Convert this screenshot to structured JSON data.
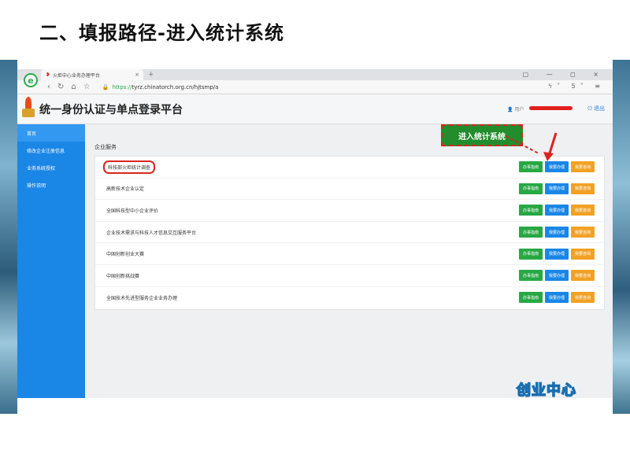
{
  "slide": {
    "title": "二、填报路径-进入统计系统"
  },
  "browser": {
    "logo": "e",
    "tab_title": "火炬中心业务办理平台",
    "tab_close": "×",
    "new_tab": "+",
    "window_controls": "▢ — ◻ ×",
    "nav_back": "‹",
    "nav_refresh": "↻",
    "nav_home": "⌂",
    "nav_star": "☆",
    "url_scheme": "https://",
    "url_rest": "tyrz.chinatorch.org.cn/hjtsmp/a",
    "addr_right": "ϟ˅ 5˅ ≡"
  },
  "app": {
    "title": "统一身份认证与单点登录平台",
    "user_label": "用户",
    "logout": "退出"
  },
  "sidebar": {
    "items": [
      {
        "label": "首页"
      },
      {
        "label": "修改企业注册信息"
      },
      {
        "label": "业务系统授权"
      },
      {
        "label": "操作说明"
      }
    ]
  },
  "main": {
    "section_title": "企业服务",
    "rows": [
      {
        "label": "科技部火炬统计调查",
        "btn1": "办事指南",
        "btn2": "我要办理",
        "btn3": "我要咨询"
      },
      {
        "label": "高新技术企业认定",
        "btn1": "办事指南",
        "btn2": "我要办理",
        "btn3": "我要咨询"
      },
      {
        "label": "全国科技型中小企业评价",
        "btn1": "办事指南",
        "btn2": "我要办理",
        "btn3": "我要咨询"
      },
      {
        "label": "企业技术需求与科技人才信息交互服务平台",
        "btn1": "办事指南",
        "btn2": "我要办理",
        "btn3": "我要咨询"
      },
      {
        "label": "中国创新创业大赛",
        "btn1": "办事指南",
        "btn2": "我要办理",
        "btn3": "我要咨询"
      },
      {
        "label": "中国创新挑战赛",
        "btn1": "办事指南",
        "btn2": "我要办理",
        "btn3": "我要咨询"
      },
      {
        "label": "全国技术先进型服务企业业务办理",
        "btn1": "办事指南",
        "btn2": "我要办理",
        "btn3": "我要咨询"
      }
    ]
  },
  "annotation": {
    "callout": "进入统计系统"
  },
  "badge": {
    "text": "创业中心"
  },
  "colors": {
    "accent_blue": "#1a86e6",
    "green": "#27a844",
    "orange": "#f2a124",
    "highlight_red": "#d9251f"
  }
}
